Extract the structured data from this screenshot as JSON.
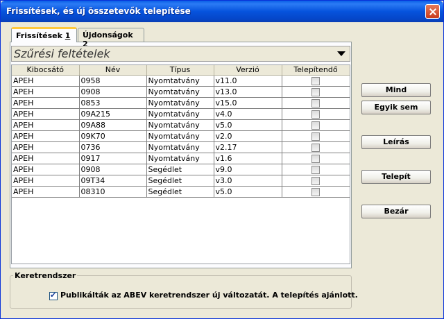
{
  "window": {
    "title": "Frissítések, és új összetevők telepítése"
  },
  "tabs": [
    {
      "label": "Frissítések",
      "key": "1",
      "active": true
    },
    {
      "label": "Újdonságok",
      "key": "2",
      "active": false
    }
  ],
  "filter": {
    "title": "Szűrési feltételek"
  },
  "table": {
    "columns": [
      "Kibocsátó",
      "Név",
      "Típus",
      "Verzió",
      "Telepítendő"
    ],
    "rows": [
      [
        "APEH",
        "0958",
        "Nyomtatvány",
        "v11.0",
        false
      ],
      [
        "APEH",
        "0908",
        "Nyomtatvány",
        "v13.0",
        false
      ],
      [
        "APEH",
        "0853",
        "Nyomtatvány",
        "v15.0",
        false
      ],
      [
        "APEH",
        "09A215",
        "Nyomtatvány",
        "v4.0",
        false
      ],
      [
        "APEH",
        "09A88",
        "Nyomtatvány",
        "v5.0",
        false
      ],
      [
        "APEH",
        "09K70",
        "Nyomtatvány",
        "v2.0",
        false
      ],
      [
        "APEH",
        "0736",
        "Nyomtatvány",
        "v2.17",
        false
      ],
      [
        "APEH",
        "0917",
        "Nyomtatvány",
        "v1.6",
        false
      ],
      [
        "APEH",
        "0908",
        "Segédlet",
        "v9.0",
        false
      ],
      [
        "APEH",
        "09T34",
        "Segédlet",
        "v3.0",
        false
      ],
      [
        "APEH",
        "08310",
        "Segédlet",
        "v5.0",
        false
      ]
    ]
  },
  "buttons": {
    "all": "Mind",
    "none": "Egyik sem",
    "description": "Leírás",
    "install": "Telepít",
    "close": "Bezár"
  },
  "framework": {
    "legend": "Keretrendszer",
    "message": "Publikálták az ABEV keretrendszer új változatát. A telepítés ajánlott.",
    "checked": true
  },
  "colors": {
    "titlebar": "#0653dd",
    "tab_highlight": "#ffc83c",
    "window_bg": "#ece9d8"
  }
}
